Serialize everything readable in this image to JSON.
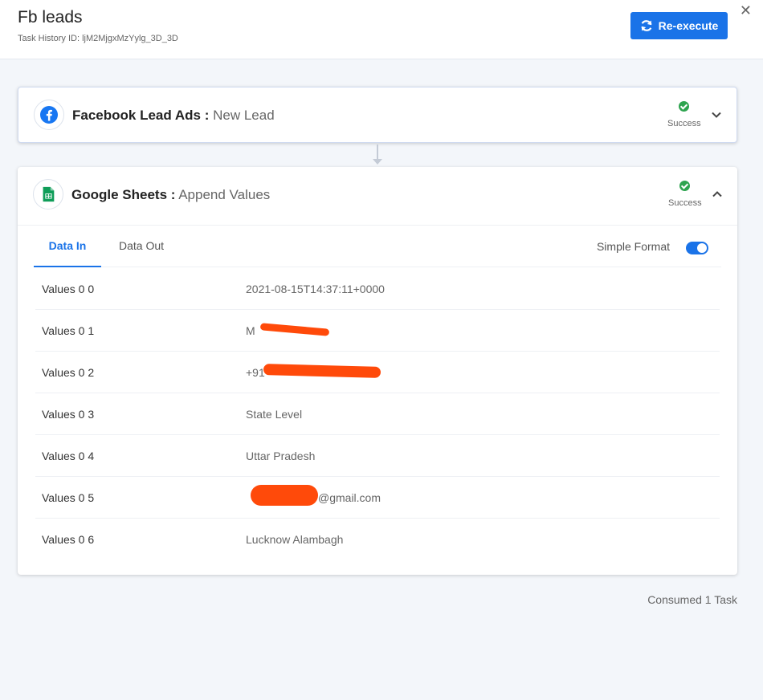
{
  "header": {
    "title": "Fb leads",
    "task_history": "Task History ID: ljM2MjgxMzYylg_3D_3D",
    "reexecute_label": "Re-execute",
    "close_glyph": "✕"
  },
  "steps": [
    {
      "app": "Facebook Lead Ads :",
      "event": "New Lead",
      "icon": "facebook-icon",
      "status": "Success",
      "expanded": false
    },
    {
      "app": "Google Sheets :",
      "event": "Append Values",
      "icon": "google-sheets-icon",
      "status": "Success",
      "expanded": true
    }
  ],
  "tabs": {
    "data_in": "Data In",
    "data_out": "Data Out",
    "active": "data_in"
  },
  "simple_format": {
    "label": "Simple Format",
    "enabled": true
  },
  "rows": [
    {
      "key": "Values 0 0",
      "value": "2021-08-15T14:37:11+0000"
    },
    {
      "key": "Values 0 1",
      "value": "M"
    },
    {
      "key": "Values 0 2",
      "value": "+91"
    },
    {
      "key": "Values 0 3",
      "value": "State Level"
    },
    {
      "key": "Values 0 4",
      "value": "Uttar Pradesh"
    },
    {
      "key": "Values 0 5",
      "value": "@gmail.com"
    },
    {
      "key": "Values 0 6",
      "value": "Lucknow Alambagh"
    }
  ],
  "footer": "Consumed 1 Task",
  "colors": {
    "accent": "#1a73e8",
    "success": "#2ea44f",
    "redaction": "#ff4a0a"
  }
}
